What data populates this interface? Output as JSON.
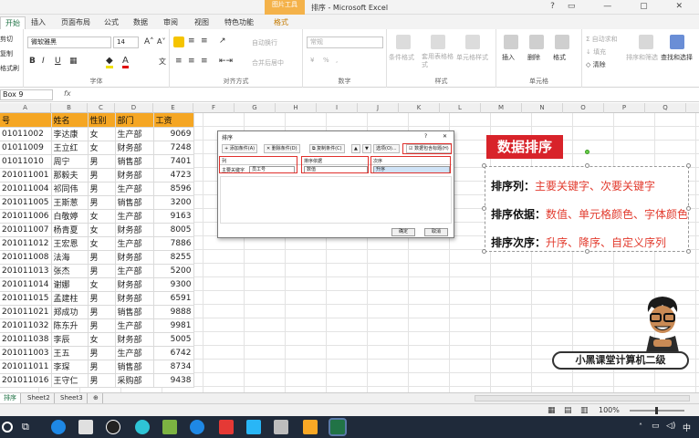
{
  "app": {
    "title": "排序 - Microsoft Excel",
    "context_tab_top": "图片工具",
    "context_tab": "格式"
  },
  "tabs": [
    "开始",
    "插入",
    "页面布局",
    "公式",
    "数据",
    "审阅",
    "视图",
    "特色功能",
    "格式"
  ],
  "ribbon": {
    "clip_cut": "剪切",
    "clip_copy": "复制",
    "clip_painter": "格式刷",
    "font_name": "微软雅黑",
    "font_size": "14",
    "font_group": "字体",
    "wrap": "自动换行",
    "merge": "合并后居中",
    "align_group": "对齐方式",
    "number_format": "常规",
    "number_group": "数字",
    "cond_format": "条件格式",
    "table_format": "套用表格格式",
    "cell_style": "单元格样式",
    "style_group": "样式",
    "insert": "插入",
    "delete": "删除",
    "format": "格式",
    "cells_group": "单元格",
    "autosum": "自动求和",
    "fill": "填充",
    "clear": "清除",
    "sort_filter": "排序和筛选",
    "find_select": "查找和选择",
    "bold": "B",
    "italic": "I",
    "underline": "U",
    "font_color": "A",
    "percent": "%",
    "comma": ","
  },
  "formula": {
    "name_box": "Box 9",
    "fx": "fx"
  },
  "columns": [
    "A",
    "B",
    "C",
    "D",
    "E",
    "F",
    "G",
    "H",
    "I",
    "J",
    "K",
    "L",
    "M",
    "N",
    "O",
    "P",
    "Q"
  ],
  "table": {
    "headers": [
      "号",
      "姓名",
      "性别",
      "部门",
      "工资"
    ],
    "rows": [
      [
        "01011002",
        "李达康",
        "女",
        "生产部",
        "9069"
      ],
      [
        "01011009",
        "王立红",
        "女",
        "财务部",
        "7248"
      ],
      [
        "01011010",
        "周宁",
        "男",
        "销售部",
        "7401"
      ],
      [
        "201011001",
        "那毅夫",
        "男",
        "财务部",
        "4723"
      ],
      [
        "201011004",
        "祁同伟",
        "男",
        "生产部",
        "8596"
      ],
      [
        "201011005",
        "王斯葱",
        "男",
        "销售部",
        "3200"
      ],
      [
        "201011006",
        "白敬婷",
        "女",
        "生产部",
        "9163"
      ],
      [
        "201011007",
        "杨青夏",
        "女",
        "财务部",
        "8005"
      ],
      [
        "201011012",
        "王宏恩",
        "女",
        "生产部",
        "7886"
      ],
      [
        "201011008",
        "法海",
        "男",
        "财务部",
        "8255"
      ],
      [
        "201011013",
        "张杰",
        "男",
        "生产部",
        "5200"
      ],
      [
        "201011014",
        "谢娜",
        "女",
        "财务部",
        "9300"
      ],
      [
        "201011015",
        "孟建柱",
        "男",
        "财务部",
        "6591"
      ],
      [
        "201011021",
        "郑成功",
        "男",
        "销售部",
        "9888"
      ],
      [
        "201011032",
        "陈东升",
        "男",
        "生产部",
        "9981"
      ],
      [
        "201011038",
        "李辰",
        "女",
        "财务部",
        "5005"
      ],
      [
        "201011003",
        "王五",
        "男",
        "生产部",
        "6742"
      ],
      [
        "201011011",
        "李琛",
        "男",
        "销售部",
        "8734"
      ],
      [
        "201011016",
        "王守仁",
        "男",
        "采购部",
        "9438"
      ]
    ]
  },
  "sheets": [
    "排序",
    "Sheet2",
    "Sheet3"
  ],
  "dialog": {
    "title": "排序",
    "add": "添加条件(A)",
    "remove": "删除条件(D)",
    "copy": "复制条件(C)",
    "options": "选项(O)...",
    "has_header": "数据包含标题(H)",
    "col_header": "列",
    "sort_on_header": "排序依据",
    "order_header": "次序",
    "key_label": "主要关键字",
    "key_value": "员工号",
    "sort_on_value": "数值",
    "order_value": "升序",
    "ok": "确定",
    "cancel": "取消",
    "help": "?"
  },
  "annotation": {
    "title": "数据排序",
    "line1_label": "排序列：",
    "line1_text": "主要关键字、次要关键字",
    "line2_label": "排序依据：",
    "line2_text": "数值、单元格颜色、字体颜色",
    "line3_label": "排序次序：",
    "line3_text": "升序、降序、自定义序列"
  },
  "brand": "小黑课堂计算机二级",
  "status": {
    "zoom": "100%"
  },
  "tray": {
    "ime": "中"
  }
}
